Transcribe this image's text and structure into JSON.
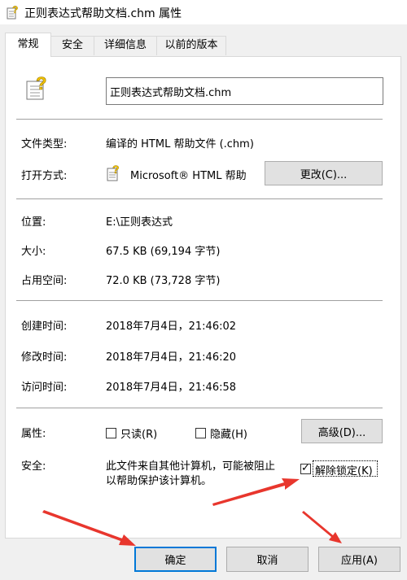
{
  "window": {
    "title": "正则表达式帮助文档.chm 属性"
  },
  "tabs": [
    {
      "label": "常规"
    },
    {
      "label": "安全"
    },
    {
      "label": "详细信息"
    },
    {
      "label": "以前的版本"
    }
  ],
  "file": {
    "name": "正则表达式帮助文档.chm"
  },
  "props": {
    "type_label": "文件类型:",
    "type_value": "编译的 HTML 帮助文件 (.chm)",
    "open_label": "打开方式:",
    "open_value": "Microsoft® HTML 帮助",
    "change_button": "更改(C)...",
    "location_label": "位置:",
    "location_value": "E:\\正则表达式",
    "size_label": "大小:",
    "size_value": "67.5 KB (69,194 字节)",
    "disk_label": "占用空间:",
    "disk_value": "72.0 KB (73,728 字节)",
    "created_label": "创建时间:",
    "created_value": "2018年7月4日，21:46:02",
    "modified_label": "修改时间:",
    "modified_value": "2018年7月4日，21:46:20",
    "accessed_label": "访问时间:",
    "accessed_value": "2018年7月4日，21:46:58",
    "attributes_label": "属性:",
    "readonly_label": "只读(R)",
    "readonly_checked": false,
    "hidden_label": "隐藏(H)",
    "hidden_checked": false,
    "advanced_button": "高级(D)...",
    "security_label": "安全:",
    "security_text_line1": "此文件来自其他计算机，可能被阻止",
    "security_text_line2": "以帮助保护该计算机。",
    "unblock_label": "解除锁定(K)",
    "unblock_checked": true
  },
  "buttons": {
    "ok": "确定",
    "cancel": "取消",
    "apply": "应用(A)"
  },
  "colors": {
    "arrow": "#e8362d",
    "focus": "#0078d7"
  }
}
